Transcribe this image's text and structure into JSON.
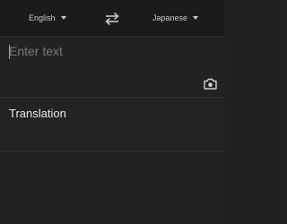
{
  "language_bar": {
    "source_language": "English",
    "target_language": "Japanese",
    "swap_icon": "swap-arrows-icon"
  },
  "input": {
    "placeholder": "Enter text",
    "value": "",
    "camera_icon": "camera-icon"
  },
  "output": {
    "label": "Translation"
  },
  "colors": {
    "background": "#222222",
    "text": "#ececec",
    "muted": "#7a7a7a"
  }
}
